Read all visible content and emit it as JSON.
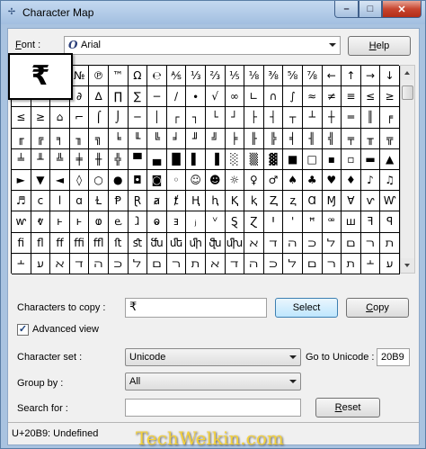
{
  "window": {
    "title": "Character Map",
    "min_label": "–",
    "max_label": "□",
    "close_label": "✕"
  },
  "font": {
    "label_prefix": "",
    "label_ul": "F",
    "label_rest": "ont :",
    "value": "Arial",
    "help_label": "Help",
    "help_ul": "H",
    "help_rest": "elp"
  },
  "grid": {
    "rows": [
      [
        "",
        "",
        "‰",
        "№",
        "℗",
        "™",
        "Ω",
        "℮",
        "⅍",
        "⅓",
        "⅔",
        "⅕",
        "⅛",
        "⅜",
        "⅝",
        "⅞",
        "←",
        "↑",
        "→",
        "↓"
      ],
      [
        "↔",
        "↕",
        "↨",
        "∂",
        "∆",
        "∏",
        "∑",
        "−",
        "∕",
        "∙",
        "√",
        "∞",
        "∟",
        "∩",
        "∫",
        "≈",
        "≠",
        "≡",
        "≤",
        "≥"
      ],
      [
        "≤",
        "≥",
        "⌂",
        "⌐",
        "⌠",
        "⌡",
        "─",
        "│",
        "┌",
        "┐",
        "└",
        "┘",
        "├",
        "┤",
        "┬",
        "┴",
        "┼",
        "═",
        "║",
        "╒"
      ],
      [
        "╓",
        "╔",
        "╕",
        "╖",
        "╗",
        "╘",
        "╙",
        "╚",
        "╛",
        "╜",
        "╝",
        "╞",
        "╟",
        "╠",
        "╡",
        "╢",
        "╣",
        "╤",
        "╥",
        "╦"
      ],
      [
        "╧",
        "╨",
        "╩",
        "╪",
        "╫",
        "╬",
        "▀",
        "▄",
        "█",
        "▌",
        "▐",
        "░",
        "▒",
        "▓",
        "■",
        "□",
        "▪",
        "▫",
        "▬",
        "▲"
      ],
      [
        "►",
        "▼",
        "◄",
        "◊",
        "○",
        "●",
        "◘",
        "◙",
        "◦",
        "☺",
        "☻",
        "☼",
        "♀",
        "♂",
        "♠",
        "♣",
        "♥",
        "♦",
        "♪",
        "♫"
      ],
      [
        "♬",
        "ⅽ",
        "ⅼ",
        "ɑ",
        "Ɫ",
        "Ᵽ",
        "Ɽ",
        "ⱥ",
        "ⱦ",
        "Ⱨ",
        "ⱨ",
        "Ⱪ",
        "ⱪ",
        "Ⱬ",
        "ⱬ",
        "Ɑ",
        "Ɱ",
        "Ɐ",
        "ⱱ",
        "Ⱳ"
      ],
      [
        "ⱳ",
        "ⱴ",
        "ⱶ",
        "ⱶ",
        "ⱷ",
        "ⱸ",
        "ⱹ",
        "ⱺ",
        "ⱻ",
        "ⱼ",
        "ⱽ",
        "Ȿ",
        "Ɀ",
        "Ꞌ",
        "ꞌ",
        "ꟸ",
        "ꟹ",
        "ꟺ",
        "ꟻ",
        "ꟼ"
      ],
      [
        "ﬁ",
        "ﬂ",
        "ﬀ",
        "ﬃ",
        "ﬄ",
        "ﬅ",
        "ﬆ",
        "ﬓ",
        "ﬔ",
        "ﬕ",
        "ﬖ",
        "ﬗ",
        "ﬡ",
        "ﬢ",
        "ﬣ",
        "ﬤ",
        "ﬥ",
        "ﬦ",
        "ﬧ",
        "ﬨ"
      ],
      [
        "﬩",
        "ﬠ",
        "ﬡ",
        "ﬢ",
        "ﬣ",
        "ﬤ",
        "ﬥ",
        "ﬦ",
        "ﬧ",
        "ﬨ",
        "ﬡ",
        "ﬢ",
        "ﬣ",
        "ﬤ",
        "ﬥ",
        "ﬦ",
        "ﬧ",
        "ﬨ",
        "﬩",
        "ﬠ"
      ]
    ],
    "selected_char": "₹"
  },
  "controls": {
    "chars_to_copy_label": "Characters to copy :",
    "chars_to_copy_ul": "h",
    "chars_to_copy_value": "₹",
    "select_label": "Select",
    "copy_label": "Copy",
    "copy_ul": "C",
    "copy_rest": "opy",
    "advanced_view_label": "Advanced view",
    "advanced_view_ul": "v",
    "advanced_view_checked": "✓",
    "character_set_label": "Character set :",
    "character_set_ul": "t",
    "character_set_value": "Unicode",
    "goto_unicode_label": "Go to Unicode :",
    "goto_unicode_ul": "U",
    "goto_unicode_value": "20B9",
    "group_by_label": "Group by :",
    "group_by_ul": "G",
    "group_by_value": "All",
    "search_for_label": "Search for :",
    "search_for_ul": "e",
    "search_for_value": "",
    "reset_label": "Reset",
    "reset_ul": "R",
    "reset_rest": "eset"
  },
  "status": {
    "text": "U+20B9: Undefined",
    "watermark": "TechWelkin.com"
  }
}
